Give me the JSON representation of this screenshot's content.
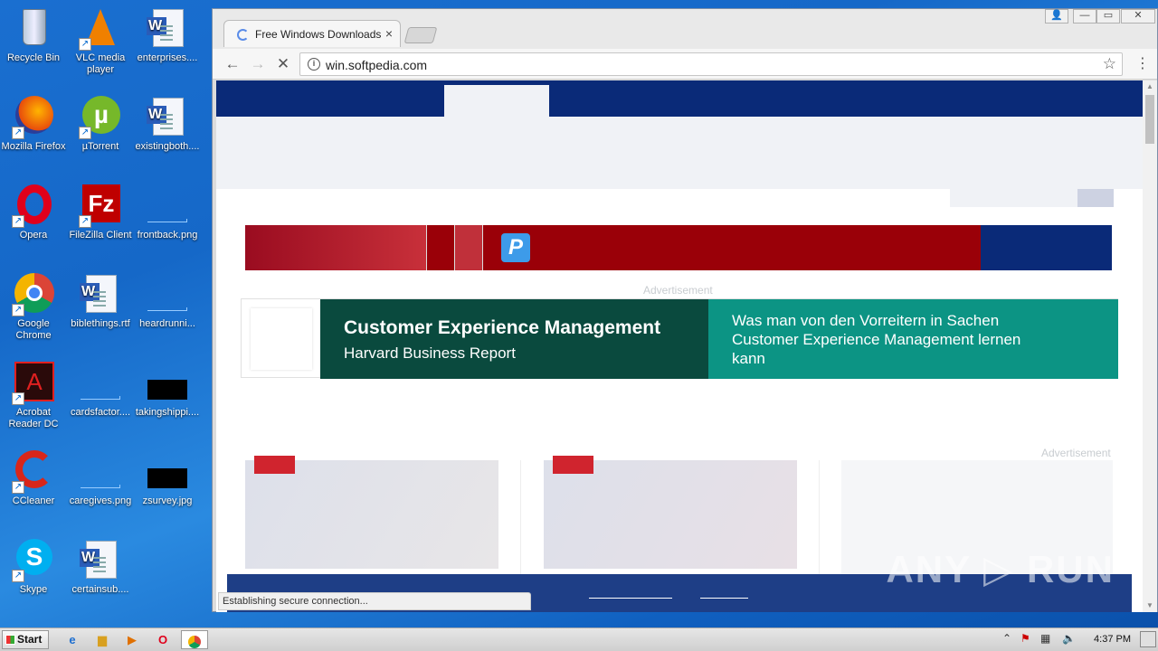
{
  "desktop": {
    "icons": [
      {
        "label": "Recycle Bin"
      },
      {
        "label": "VLC media player"
      },
      {
        "label": "enterprises...."
      },
      {
        "label": "Mozilla Firefox"
      },
      {
        "label": "µTorrent"
      },
      {
        "label": "existingboth...."
      },
      {
        "label": "Opera"
      },
      {
        "label": "FileZilla Client"
      },
      {
        "label": "frontback.png"
      },
      {
        "label": "Google Chrome"
      },
      {
        "label": "biblethings.rtf"
      },
      {
        "label": "heardrunni..."
      },
      {
        "label": "Acrobat Reader DC"
      },
      {
        "label": "cardsfactor...."
      },
      {
        "label": "takingshippi...."
      },
      {
        "label": "CCleaner"
      },
      {
        "label": "caregives.png"
      },
      {
        "label": "zsurvey.jpg"
      },
      {
        "label": "Skype"
      },
      {
        "label": "certainsub...."
      }
    ]
  },
  "browser": {
    "tab_title": "Free Windows Downloads",
    "tab_close": "×",
    "url": "win.softpedia.com",
    "status": "Establishing secure connection...",
    "window_buttons": {
      "user": "👤",
      "minimize": "—",
      "restore": "▭",
      "close": "✕"
    }
  },
  "page": {
    "ad_label_1": "Advertisement",
    "ad_label_2": "Advertisement",
    "banner_badge": "P",
    "cxm": {
      "title": "Customer Experience Management",
      "subtitle": "Harvard Business Report",
      "text": "Was man von den Vorreitern in Sachen Customer Experience Management lernen kann"
    }
  },
  "watermark": "ANY ▷ RUN",
  "taskbar": {
    "start_label": "Start",
    "clock": "4:37 PM"
  },
  "colors": {
    "nav_blue": "#0a2a78",
    "banner_red": "#9a0008",
    "cxm_dark": "#0a4a3e",
    "cxm_teal": "#0c9484",
    "tag_red": "#d0242e"
  }
}
